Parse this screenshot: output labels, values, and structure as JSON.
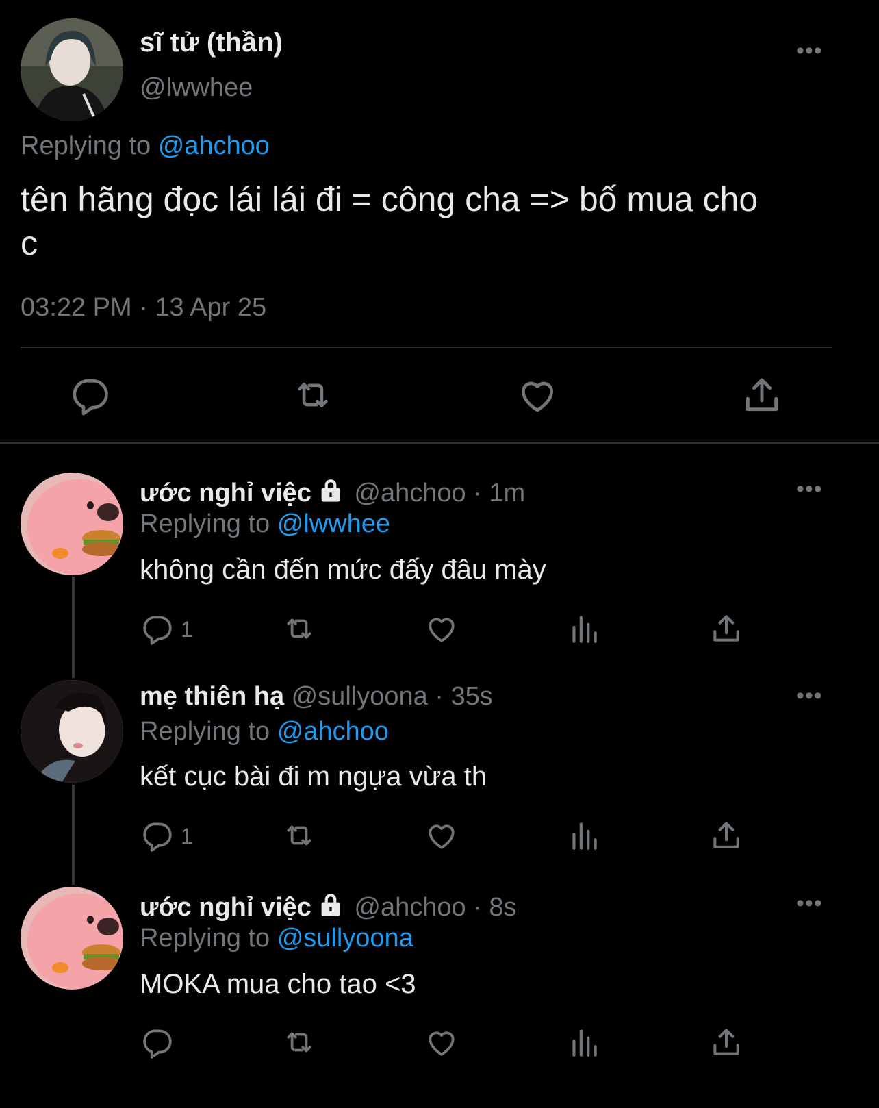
{
  "main_tweet": {
    "display_name": "sĩ tử (thần)",
    "handle": "@lwwhee",
    "replying_prefix": "Replying to",
    "replying_to": "@ahchoo",
    "text_line1": "tên hãng đọc lái lái đi = công cha => bố mua cho",
    "text_line2": "c",
    "timestamp": "03:22 PM · 13 Apr 25"
  },
  "replies": [
    {
      "display_name": "ước nghỉ việc",
      "locked": true,
      "meta": "@ahchoo · 1m",
      "replying_prefix": "Replying to",
      "replying_to": "@lwwhee",
      "text": "không cần đến mức đấy đâu mày",
      "reply_count": "1"
    },
    {
      "display_name": "mẹ thiên hạ",
      "locked": false,
      "meta": "@sullyoona · 35s",
      "replying_prefix": "Replying to",
      "replying_to": "@ahchoo",
      "text": "kết cục bài đi m ngựa vừa th",
      "reply_count": "1"
    },
    {
      "display_name": "ước nghỉ việc",
      "locked": true,
      "meta": "@ahchoo · 8s",
      "replying_prefix": "Replying to",
      "replying_to": "@sullyoona",
      "text": "MOKA mua cho tao <3",
      "reply_count": ""
    }
  ],
  "more_glyph": "•••",
  "colors": {
    "background": "#000000",
    "text": "#e7e9ea",
    "muted": "#71767b",
    "link": "#1d9bf0",
    "divider": "#2f3336"
  },
  "icons": [
    "reply-icon",
    "retweet-icon",
    "like-icon",
    "views-icon",
    "share-icon",
    "lock-icon",
    "more-icon"
  ]
}
